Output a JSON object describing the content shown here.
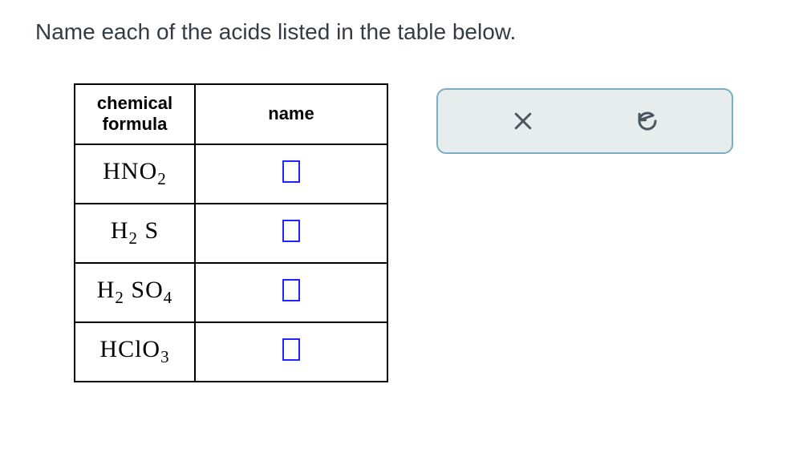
{
  "question": "Name each of the acids listed in the table below.",
  "table": {
    "headers": {
      "formula": "chemical formula",
      "name": "name"
    },
    "rows": [
      {
        "formula_html": "HNO<sub>2</sub>"
      },
      {
        "formula_html": "H<sub>2</sub> S"
      },
      {
        "formula_html": "H<sub>2</sub> SO<sub>4</sub>"
      },
      {
        "formula_html": "HClO<sub>3</sub>"
      }
    ]
  },
  "actions": {
    "clear_label": "Clear",
    "reset_label": "Reset"
  }
}
